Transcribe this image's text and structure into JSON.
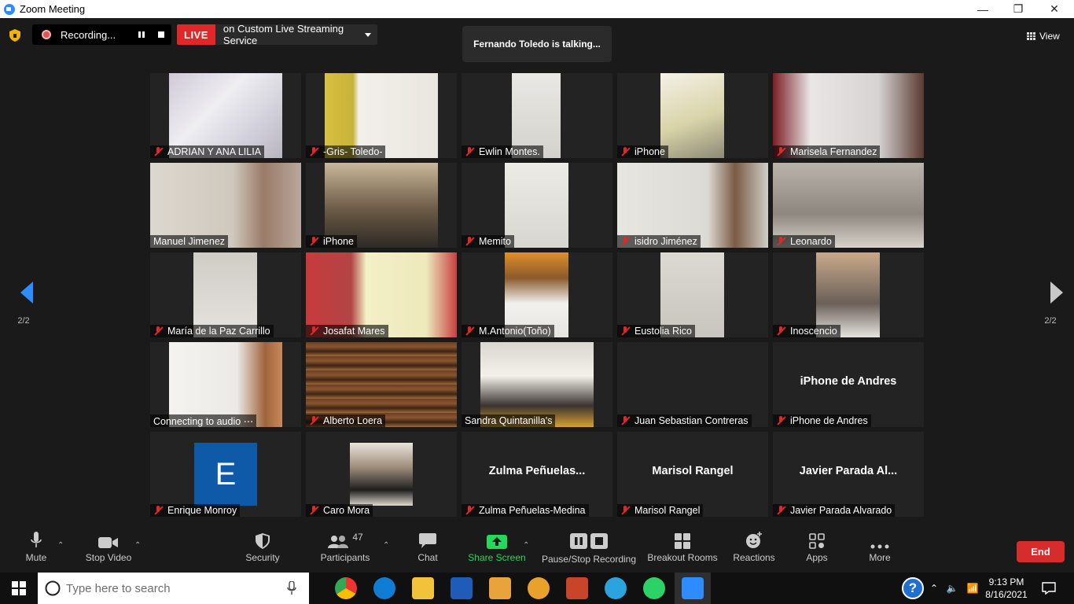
{
  "window": {
    "title": "Zoom Meeting"
  },
  "topbar": {
    "recording_label": "Recording...",
    "live_badge": "LIVE",
    "live_text": "on Custom Live Streaming Service",
    "talking": "Fernando Toledo is talking...",
    "view_label": "View"
  },
  "pager": {
    "left": "2/2",
    "right": "2/2"
  },
  "participants": [
    "ADRIAN Y ANA LILIA",
    "-Gris- Toledo-",
    "Ewlin Montes.",
    "iPhone",
    "Marisela Fernandez",
    "Manuel  Jimenez",
    "iPhone",
    "Memito",
    "isidro Jiménez",
    "Leonardo",
    "María de la Paz Carrillo",
    "Josafat Mares",
    "M.Antonio(Toño)",
    "Eustolia Rico",
    "Inoscencio",
    "Connecting to audio ⋯",
    "Alberto Loera",
    "Sandra Quintanilla's",
    "Juan Sebastian Contreras",
    "iPhone de Andres",
    "Enrique Monroy",
    "Caro Mora",
    "Zulma Peñuelas-Medina",
    "Marisol Rangel",
    "Javier Parada Alvarado"
  ],
  "tile_big_names": {
    "iphone_andres": "iPhone de Andres",
    "zulma": "Zulma  Peñuelas...",
    "marisol": "Marisol Rangel",
    "javier": "Javier Parada Al..."
  },
  "avatar_letter": "E",
  "toolbar": {
    "mute": "Mute",
    "stop_video": "Stop Video",
    "security": "Security",
    "participants": "Participants",
    "participants_count": "47",
    "chat": "Chat",
    "share_screen": "Share Screen",
    "recording": "Pause/Stop Recording",
    "breakout": "Breakout Rooms",
    "reactions": "Reactions",
    "apps": "Apps",
    "more": "More",
    "end": "End"
  },
  "taskbar": {
    "search_placeholder": "Type here to search",
    "time": "9:13 PM",
    "date": "8/16/2021"
  },
  "colors": {
    "accent": "#2d8cff",
    "end": "#d62c2c",
    "live": "#e02828",
    "share": "#23d959"
  }
}
